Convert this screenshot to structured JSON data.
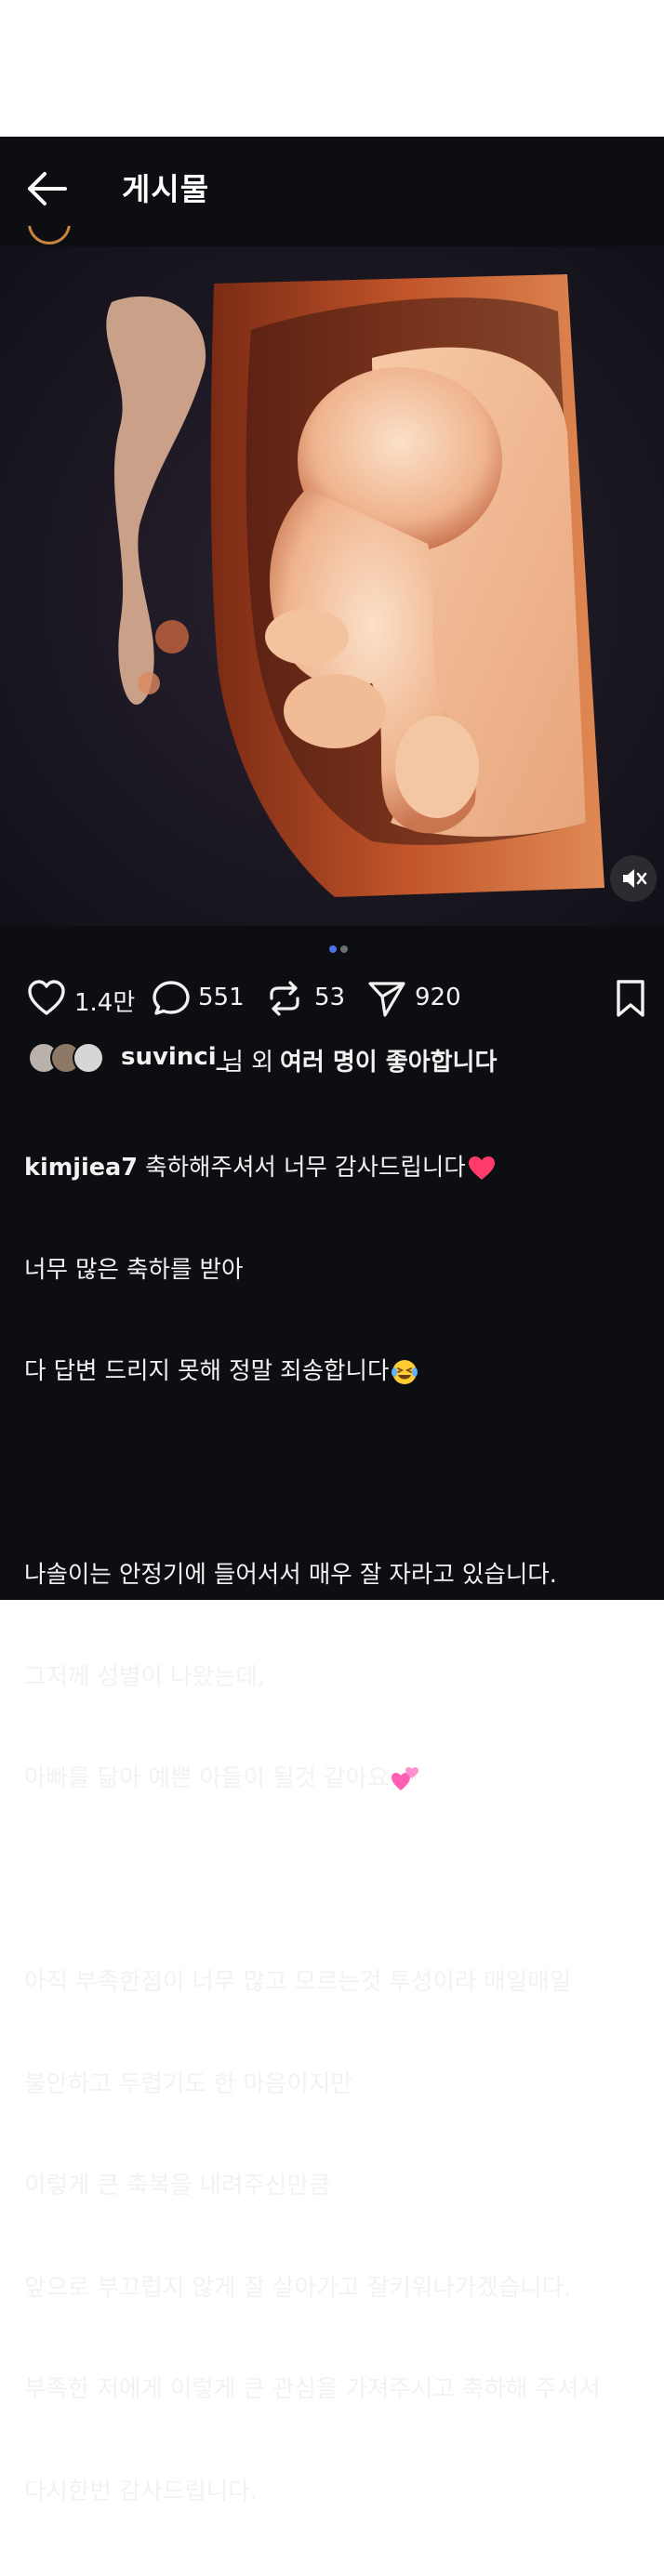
{
  "header": {
    "title": "게시물"
  },
  "actions": {
    "likes": "1.4만",
    "comments": "551",
    "reposts": "53",
    "shares": "920"
  },
  "liked_by": {
    "user": "suvinci_",
    "mid": "님 외",
    "strong": "여러 명이 좋아합니다"
  },
  "caption": {
    "username": "kimjiea7",
    "lines": [
      " 축하해주셔서 너무 감사드립니다",
      "너무 많은 축하를 받아",
      "다 답변 드리지 못해 정말 죄송합니다",
      "",
      "나솔이는 안정기에 들어서서 매우 잘 자라고 있습니다.",
      "그저께 성별이 나왔는데,",
      "아빠를 닮아 예쁜 아들이 될것 같아요",
      "",
      "아직 부족한점이 너무 많고 모르는것 투성이라 매일매일",
      "불안하고 두렵기도 한 마음이지만",
      "이렇게 큰 축복을 내려주신만큼",
      "앞으로 부끄럽지 않게 잘 살아가고 잘키워나가겠습니다.",
      "부족한 저에게 이렇게 큰 관심을 가져주시고 축하해 주셔서",
      "다시한번 감사드립니다."
    ]
  },
  "icons": {
    "back": "arrow-left-icon",
    "like": "heart-icon",
    "comment": "comment-icon",
    "repost": "repost-icon",
    "share": "send-icon",
    "save": "bookmark-icon",
    "mute": "speaker-muted-icon"
  },
  "colors": {
    "background": "#0c0e12",
    "text": "#f2f2f2",
    "dot_active": "#4a74e8",
    "dot_inactive": "#6b6e75",
    "heart_emoji": "#ff3b6b",
    "hearts_emoji": "#ff5fb3"
  },
  "carousel": {
    "current": 1,
    "total": 2
  }
}
